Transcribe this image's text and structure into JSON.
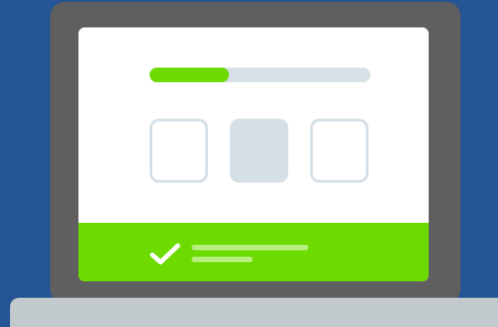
{
  "illustration": {
    "kind": "laptop-quiz-success-illustration",
    "progress": {
      "value_fraction": 0.36
    },
    "options": [
      {
        "state": "unselected"
      },
      {
        "state": "selected"
      },
      {
        "state": "unselected"
      }
    ],
    "banner": {
      "status": "success",
      "icon": "check-icon"
    }
  },
  "colors": {
    "background": "#255594",
    "laptop_lid": "#5f5f5f",
    "laptop_base": "#c2cacd",
    "screen": "#ffffff",
    "progress_track": "#d7e0e4",
    "progress_fill": "#6ddb00",
    "option_border": "#d4e0e6",
    "option_selected_fill": "#d4e0e6",
    "banner": "#6ddb00",
    "check": "#ffffff",
    "banner_text_lines": "#b7ee7f"
  }
}
